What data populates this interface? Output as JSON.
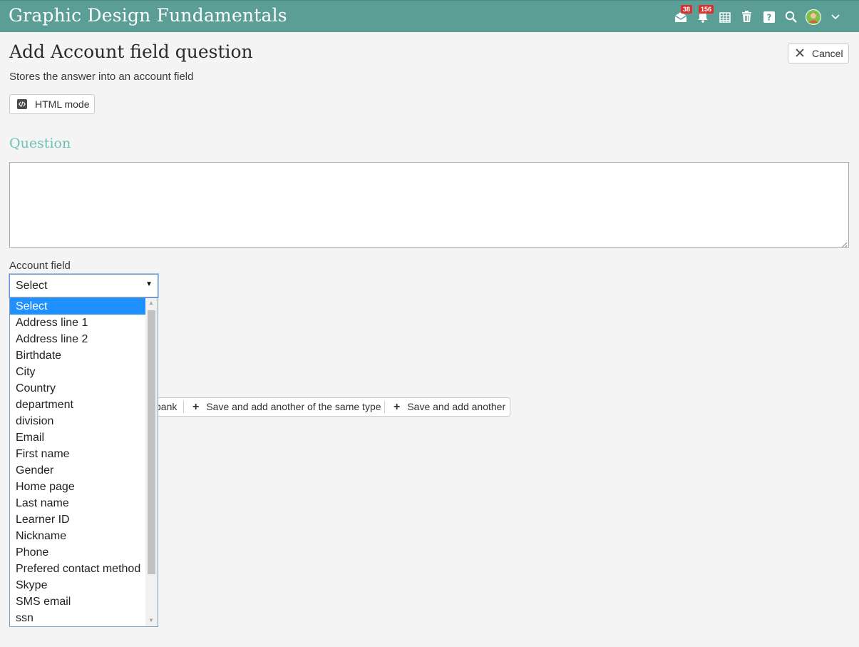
{
  "app": {
    "title": "Graphic Design Fundamentals"
  },
  "topbar": {
    "messages_badge": "38",
    "notifications_badge": "156",
    "accent_color": "#5a9e96",
    "icons": [
      "mail-icon",
      "bell-icon",
      "calendar-icon",
      "trash-icon",
      "help-icon",
      "search-icon",
      "avatar",
      "chevron-down-icon"
    ]
  },
  "page": {
    "title": "Add Account field question",
    "subtitle": "Stores the answer into an account field",
    "cancel_label": "Cancel",
    "html_mode_label": "HTML mode"
  },
  "question": {
    "section_title": "Question",
    "text": "",
    "heading_color": "#6bc2b6"
  },
  "account_field": {
    "label": "Account field",
    "selected": "Select",
    "options": [
      "Select",
      "Address line 1",
      "Address line 2",
      "Birthdate",
      "City",
      "Country",
      "department",
      "division",
      "Email",
      "First name",
      "Gender",
      "Home page",
      "Last name",
      "Learner ID",
      "Nickname",
      "Phone",
      "Prefered contact method",
      "Skype",
      "SMS email",
      "ssn"
    ]
  },
  "actions": {
    "partial_label": "bank",
    "save_add_same_type": "Save and add another of the same type",
    "save_add_another": "Save and add another"
  }
}
